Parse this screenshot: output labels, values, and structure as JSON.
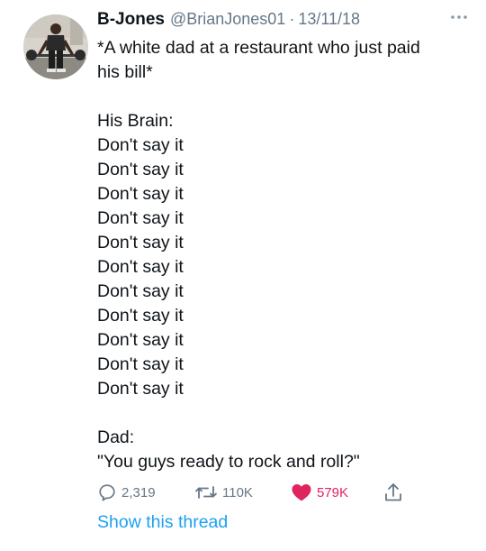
{
  "tweet": {
    "author_name": "B-Jones",
    "handle": "@BrianJones01",
    "separator": "·",
    "date": "13/11/18",
    "avatar_icon": "avatar-photo",
    "more_icon": "more-dots-icon",
    "text_lines": [
      "*A white dad at a restaurant who just paid",
      "his bill*",
      "",
      "His Brain:",
      "Don't say it",
      "Don't say it",
      "Don't say it",
      "Don't say it",
      "Don't say it",
      "Don't say it",
      "Don't say it",
      "Don't say it",
      "Don't say it",
      "Don't say it",
      "Don't say it",
      "",
      "Dad:",
      "\"You guys ready to rock and roll?\""
    ]
  },
  "actions": {
    "reply": {
      "icon": "reply-icon",
      "count": "2,319"
    },
    "retweet": {
      "icon": "retweet-icon",
      "count": "110K"
    },
    "like": {
      "icon": "heart-icon",
      "count": "579K",
      "liked": true,
      "color": "#e0245e"
    },
    "share": {
      "icon": "share-icon"
    }
  },
  "show_thread_label": "Show this thread",
  "colors": {
    "text": "#0f1419",
    "muted": "#657786",
    "link": "#1da1f2",
    "like": "#e0245e"
  }
}
